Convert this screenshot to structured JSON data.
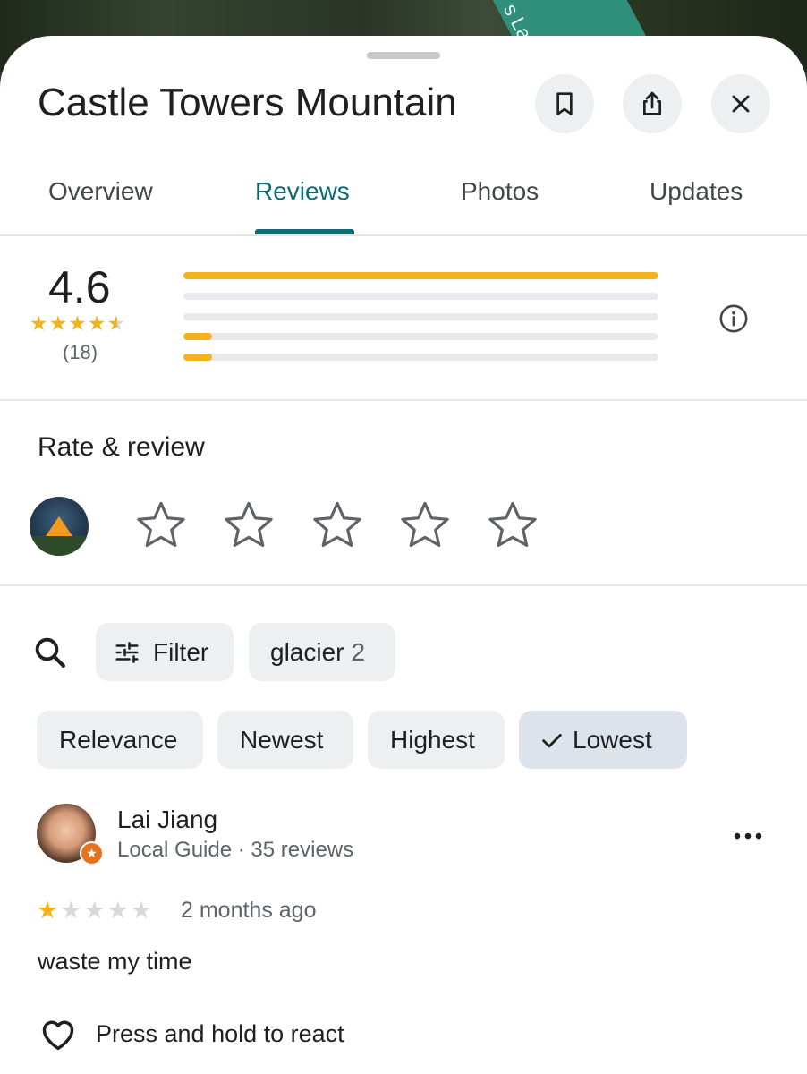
{
  "map": {
    "label": "s La"
  },
  "header": {
    "title": "Castle Towers Mountain",
    "buttons": [
      {
        "name": "save",
        "icon": "bookmark-icon"
      },
      {
        "name": "share",
        "icon": "share-icon"
      },
      {
        "name": "close",
        "icon": "close-icon"
      }
    ]
  },
  "tabs": [
    {
      "label": "Overview",
      "active": false
    },
    {
      "label": "Reviews",
      "active": true
    },
    {
      "label": "Photos",
      "active": false
    },
    {
      "label": "Updates",
      "active": false
    }
  ],
  "summary": {
    "rating": "4.6",
    "stars": 4.6,
    "count": "(18)",
    "distribution": [
      {
        "stars": 5,
        "fraction": 1.0
      },
      {
        "stars": 4,
        "fraction": 0.0
      },
      {
        "stars": 3,
        "fraction": 0.0
      },
      {
        "stars": 2,
        "fraction": 0.06
      },
      {
        "stars": 1,
        "fraction": 0.06
      }
    ],
    "info_icon": "info-icon"
  },
  "rate_review": {
    "title": "Rate & review",
    "star_count": 5
  },
  "filters": {
    "search_icon": "search-icon",
    "filter_label": "Filter",
    "keyword_label": "glacier",
    "keyword_count": "2"
  },
  "sort": [
    {
      "label": "Relevance",
      "selected": false
    },
    {
      "label": "Newest",
      "selected": false
    },
    {
      "label": "Highest",
      "selected": false
    },
    {
      "label": "Lowest",
      "selected": true
    }
  ],
  "review": {
    "author": "Lai Jiang",
    "meta": "Local Guide · 35 reviews",
    "rating": 1,
    "time": "2 months ago",
    "text": "waste my time",
    "react_label": "Press and hold to react"
  },
  "colors": {
    "accent": "#0b6d73",
    "star": "#f6b21b",
    "chip": "#eeeff1",
    "chip_selected": "#dde3ea",
    "local_guide_badge": "#e8711c"
  }
}
